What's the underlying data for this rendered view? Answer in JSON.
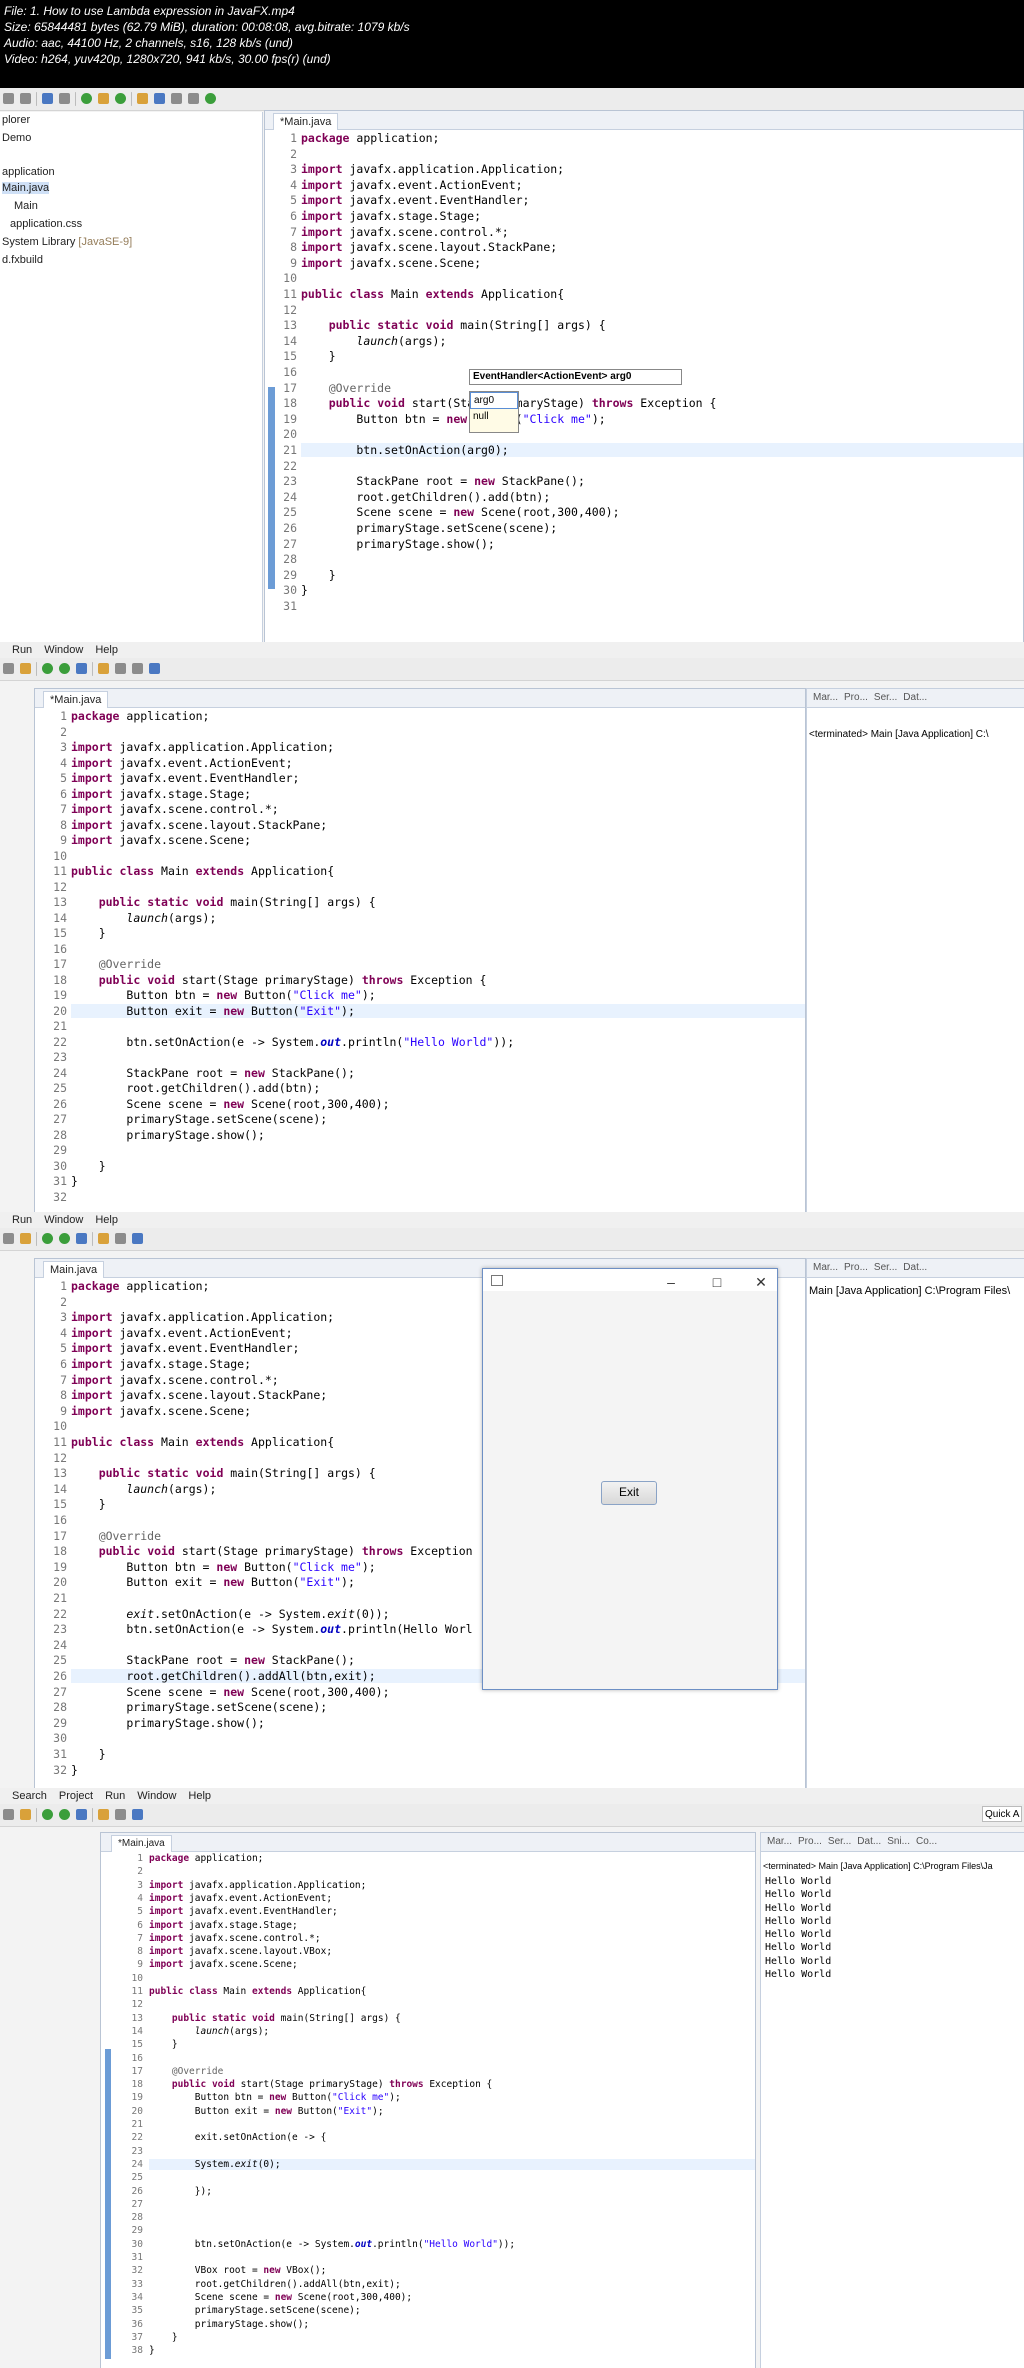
{
  "header": {
    "lines": [
      "File: 1. How to use Lambda expression in JavaFX.mp4",
      "Size: 65844481 bytes (62.79 MiB), duration: 00:08:08, avg.bitrate: 1079 kb/s",
      "Audio: aac, 44100 Hz, 2 channels, s16, 128 kb/s (und)",
      "Video: h264, yuv420p, 1280x720, 941 kb/s, 30.00 fps(r) (und)"
    ]
  },
  "frame1": {
    "explorer_title": "plorer",
    "explorer_items": [
      "Demo",
      "application",
      "Main.java",
      "Main",
      "application.css",
      "System Library",
      "[JavaSE-9]",
      "d.fxbuild"
    ],
    "tab": "*Main.java",
    "popup_header": "EventHandler<ActionEvent> arg0",
    "popup_items": [
      "arg0",
      "null"
    ]
  },
  "frame2": {
    "menu": [
      "Run",
      "Window",
      "Help"
    ],
    "tab": "*Main.java",
    "side_tabs": [
      "Mar...",
      "Pro...",
      "Ser...",
      "Dat..."
    ],
    "console": "<terminated> Main [Java Application] C:\\"
  },
  "frame3": {
    "menu": [
      "Run",
      "Window",
      "Help"
    ],
    "tab": "Main.java",
    "side_tabs": [
      "Mar...",
      "Pro...",
      "Ser...",
      "Dat..."
    ],
    "console": "Main [Java Application] C:\\Program Files\\",
    "app_button": "Exit"
  },
  "frame4": {
    "menu": [
      "Search",
      "Project",
      "Run",
      "Window",
      "Help"
    ],
    "tab": "*Main.java",
    "quick_access": "Quick A",
    "side_tabs": [
      "Mar...",
      "Pro...",
      "Ser...",
      "Dat...",
      "Sni...",
      "Co..."
    ],
    "console_header": "<terminated> Main [Java Application] C:\\Program Files\\Ja",
    "console_lines": [
      "Hello World",
      "Hello World",
      "Hello World",
      "Hello World",
      "Hello World",
      "Hello World",
      "Hello World",
      "Hello World"
    ]
  },
  "code1": [
    [
      "1",
      "package application;"
    ],
    [
      "2",
      ""
    ],
    [
      "3",
      "import javafx.application.Application;"
    ],
    [
      "4",
      "import javafx.event.ActionEvent;"
    ],
    [
      "5",
      "import javafx.event.EventHandler;"
    ],
    [
      "6",
      "import javafx.stage.Stage;"
    ],
    [
      "7",
      "import javafx.scene.control.*;"
    ],
    [
      "8",
      "import javafx.scene.layout.StackPane;"
    ],
    [
      "9",
      "import javafx.scene.Scene;"
    ],
    [
      "10",
      ""
    ],
    [
      "11",
      "public class Main extends Application{"
    ],
    [
      "12",
      ""
    ],
    [
      "13",
      "    public static void main(String[] args) {"
    ],
    [
      "14",
      "        launch(args);"
    ],
    [
      "15",
      "    }"
    ],
    [
      "16",
      ""
    ],
    [
      "17",
      "    @Override"
    ],
    [
      "18",
      "    public void start(Stage primaryStage) throws Exception {"
    ],
    [
      "19",
      "        Button btn = new Button(\"Click me\");"
    ],
    [
      "20",
      ""
    ],
    [
      "21",
      "        btn.setOnAction(arg0);"
    ],
    [
      "22",
      ""
    ],
    [
      "23",
      "        StackPane root = new StackPane();"
    ],
    [
      "24",
      "        root.getChildren().add(btn);"
    ],
    [
      "25",
      "        Scene scene = new Scene(root,300,400);"
    ],
    [
      "26",
      "        primaryStage.setScene(scene);"
    ],
    [
      "27",
      "        primaryStage.show();"
    ],
    [
      "28",
      ""
    ],
    [
      "29",
      "    }"
    ],
    [
      "30",
      "}"
    ],
    [
      "31",
      ""
    ]
  ],
  "code2": [
    [
      "1",
      "package application;"
    ],
    [
      "2",
      ""
    ],
    [
      "3",
      "import javafx.application.Application;"
    ],
    [
      "4",
      "import javafx.event.ActionEvent;"
    ],
    [
      "5",
      "import javafx.event.EventHandler;"
    ],
    [
      "6",
      "import javafx.stage.Stage;"
    ],
    [
      "7",
      "import javafx.scene.control.*;"
    ],
    [
      "8",
      "import javafx.scene.layout.StackPane;"
    ],
    [
      "9",
      "import javafx.scene.Scene;"
    ],
    [
      "10",
      ""
    ],
    [
      "11",
      "public class Main extends Application{"
    ],
    [
      "12",
      ""
    ],
    [
      "13",
      "    public static void main(String[] args) {"
    ],
    [
      "14",
      "        launch(args);"
    ],
    [
      "15",
      "    }"
    ],
    [
      "16",
      ""
    ],
    [
      "17",
      "    @Override"
    ],
    [
      "18",
      "    public void start(Stage primaryStage) throws Exception {"
    ],
    [
      "19",
      "        Button btn = new Button(\"Click me\");"
    ],
    [
      "20",
      "        Button exit = new Button(\"Exit\");"
    ],
    [
      "21",
      ""
    ],
    [
      "22",
      "        btn.setOnAction(e -> System.out.println(\"Hello World\"));"
    ],
    [
      "23",
      ""
    ],
    [
      "24",
      "        StackPane root = new StackPane();"
    ],
    [
      "25",
      "        root.getChildren().add(btn);"
    ],
    [
      "26",
      "        Scene scene = new Scene(root,300,400);"
    ],
    [
      "27",
      "        primaryStage.setScene(scene);"
    ],
    [
      "28",
      "        primaryStage.show();"
    ],
    [
      "29",
      ""
    ],
    [
      "30",
      "    }"
    ],
    [
      "31",
      "}"
    ],
    [
      "32",
      ""
    ]
  ],
  "code3": [
    [
      "1",
      "package application;"
    ],
    [
      "2",
      ""
    ],
    [
      "3",
      "import javafx.application.Application;"
    ],
    [
      "4",
      "import javafx.event.ActionEvent;"
    ],
    [
      "5",
      "import javafx.event.EventHandler;"
    ],
    [
      "6",
      "import javafx.stage.Stage;"
    ],
    [
      "7",
      "import javafx.scene.control.*;"
    ],
    [
      "8",
      "import javafx.scene.layout.StackPane;"
    ],
    [
      "9",
      "import javafx.scene.Scene;"
    ],
    [
      "10",
      ""
    ],
    [
      "11",
      "public class Main extends Application{"
    ],
    [
      "12",
      ""
    ],
    [
      "13",
      "    public static void main(String[] args) {"
    ],
    [
      "14",
      "        launch(args);"
    ],
    [
      "15",
      "    }"
    ],
    [
      "16",
      ""
    ],
    [
      "17",
      "    @Override"
    ],
    [
      "18",
      "    public void start(Stage primaryStage) throws Exception"
    ],
    [
      "19",
      "        Button btn = new Button(\"Click me\");"
    ],
    [
      "20",
      "        Button exit = new Button(\"Exit\");"
    ],
    [
      "21",
      ""
    ],
    [
      "22",
      "        exit.setOnAction(e -> System.exit(0));"
    ],
    [
      "23",
      "        btn.setOnAction(e -> System.out.println(\"Hello Worl"
    ],
    [
      "24",
      ""
    ],
    [
      "25",
      "        StackPane root = new StackPane();"
    ],
    [
      "26",
      "        root.getChildren().addAll(btn,exit);"
    ],
    [
      "27",
      "        Scene scene = new Scene(root,300,400);"
    ],
    [
      "28",
      "        primaryStage.setScene(scene);"
    ],
    [
      "29",
      "        primaryStage.show();"
    ],
    [
      "30",
      ""
    ],
    [
      "31",
      "    }"
    ],
    [
      "32",
      "}"
    ]
  ],
  "code4": [
    [
      "1",
      "package application;"
    ],
    [
      "2",
      ""
    ],
    [
      "3",
      "import javafx.application.Application;"
    ],
    [
      "4",
      "import javafx.event.ActionEvent;"
    ],
    [
      "5",
      "import javafx.event.EventHandler;"
    ],
    [
      "6",
      "import javafx.stage.Stage;"
    ],
    [
      "7",
      "import javafx.scene.control.*;"
    ],
    [
      "8",
      "import javafx.scene.layout.VBox;"
    ],
    [
      "9",
      "import javafx.scene.Scene;"
    ],
    [
      "10",
      ""
    ],
    [
      "11",
      "public class Main extends Application{"
    ],
    [
      "12",
      ""
    ],
    [
      "13",
      "    public static void main(String[] args) {"
    ],
    [
      "14",
      "        launch(args);"
    ],
    [
      "15",
      "    }"
    ],
    [
      "16",
      ""
    ],
    [
      "17",
      "    @Override"
    ],
    [
      "18",
      "    public void start(Stage primaryStage) throws Exception {"
    ],
    [
      "19",
      "        Button btn = new Button(\"Click me\");"
    ],
    [
      "20",
      "        Button exit = new Button(\"Exit\");"
    ],
    [
      "21",
      ""
    ],
    [
      "22",
      "        exit.setOnAction(e -> {"
    ],
    [
      "23",
      ""
    ],
    [
      "24",
      "        System.exit(0);"
    ],
    [
      "25",
      ""
    ],
    [
      "26",
      "        });"
    ],
    [
      "27",
      ""
    ],
    [
      "28",
      ""
    ],
    [
      "29",
      ""
    ],
    [
      "30",
      "        btn.setOnAction(e -> System.out.println(\"Hello World\"));"
    ],
    [
      "31",
      ""
    ],
    [
      "32",
      "        VBox root = new VBox();"
    ],
    [
      "33",
      "        root.getChildren().addAll(btn,exit);"
    ],
    [
      "34",
      "        Scene scene = new Scene(root,300,400);"
    ],
    [
      "35",
      "        primaryStage.setScene(scene);"
    ],
    [
      "36",
      "        primaryStage.show();"
    ],
    [
      "37",
      "    }"
    ],
    [
      "38",
      "}"
    ]
  ]
}
